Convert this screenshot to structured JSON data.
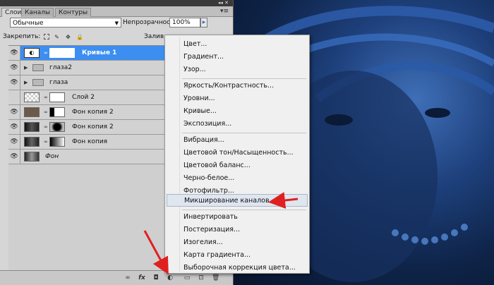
{
  "panel": {
    "tabs": [
      "Слои",
      "Каналы",
      "Контуры"
    ],
    "blend_mode": "Обычные",
    "opacity_label": "Непрозрачность:",
    "opacity_value": "100%",
    "lock_label": "Закрепить:",
    "fill_label": "Заливк"
  },
  "layers": [
    {
      "name": "Кривые 1",
      "selected": true,
      "type": "adjustment"
    },
    {
      "name": "глаза2",
      "selected": false,
      "type": "group"
    },
    {
      "name": "глаза",
      "selected": false,
      "type": "group"
    },
    {
      "name": "Слой 2",
      "selected": false,
      "type": "masked"
    },
    {
      "name": "Фон копия 2",
      "selected": false,
      "type": "masked"
    },
    {
      "name": "Фон копия 2",
      "selected": false,
      "type": "masked"
    },
    {
      "name": "Фон копия",
      "selected": false,
      "type": "masked"
    },
    {
      "name": "Фон",
      "selected": false,
      "type": "background"
    }
  ],
  "menu": {
    "group1": [
      "Цвет...",
      "Градиент...",
      "Узор..."
    ],
    "group2": [
      "Яркость/Контрастность...",
      "Уровни...",
      "Кривые...",
      "Экспозиция..."
    ],
    "group3": [
      "Вибрация...",
      "Цветовой тон/Насыщенность...",
      "Цветовой баланс...",
      "Черно-белое...",
      "Фотофильтр...",
      "Микширование каналов..."
    ],
    "group4": [
      "Инвертировать",
      "Постеризация...",
      "Изогелия...",
      "Карта градиента...",
      "Выборочная коррекция цвета..."
    ],
    "highlighted": "Микширование каналов..."
  },
  "colors": {
    "selection": "#3c8ef0",
    "arrow": "#e02020",
    "photo_blue": "#1d3f7a"
  }
}
